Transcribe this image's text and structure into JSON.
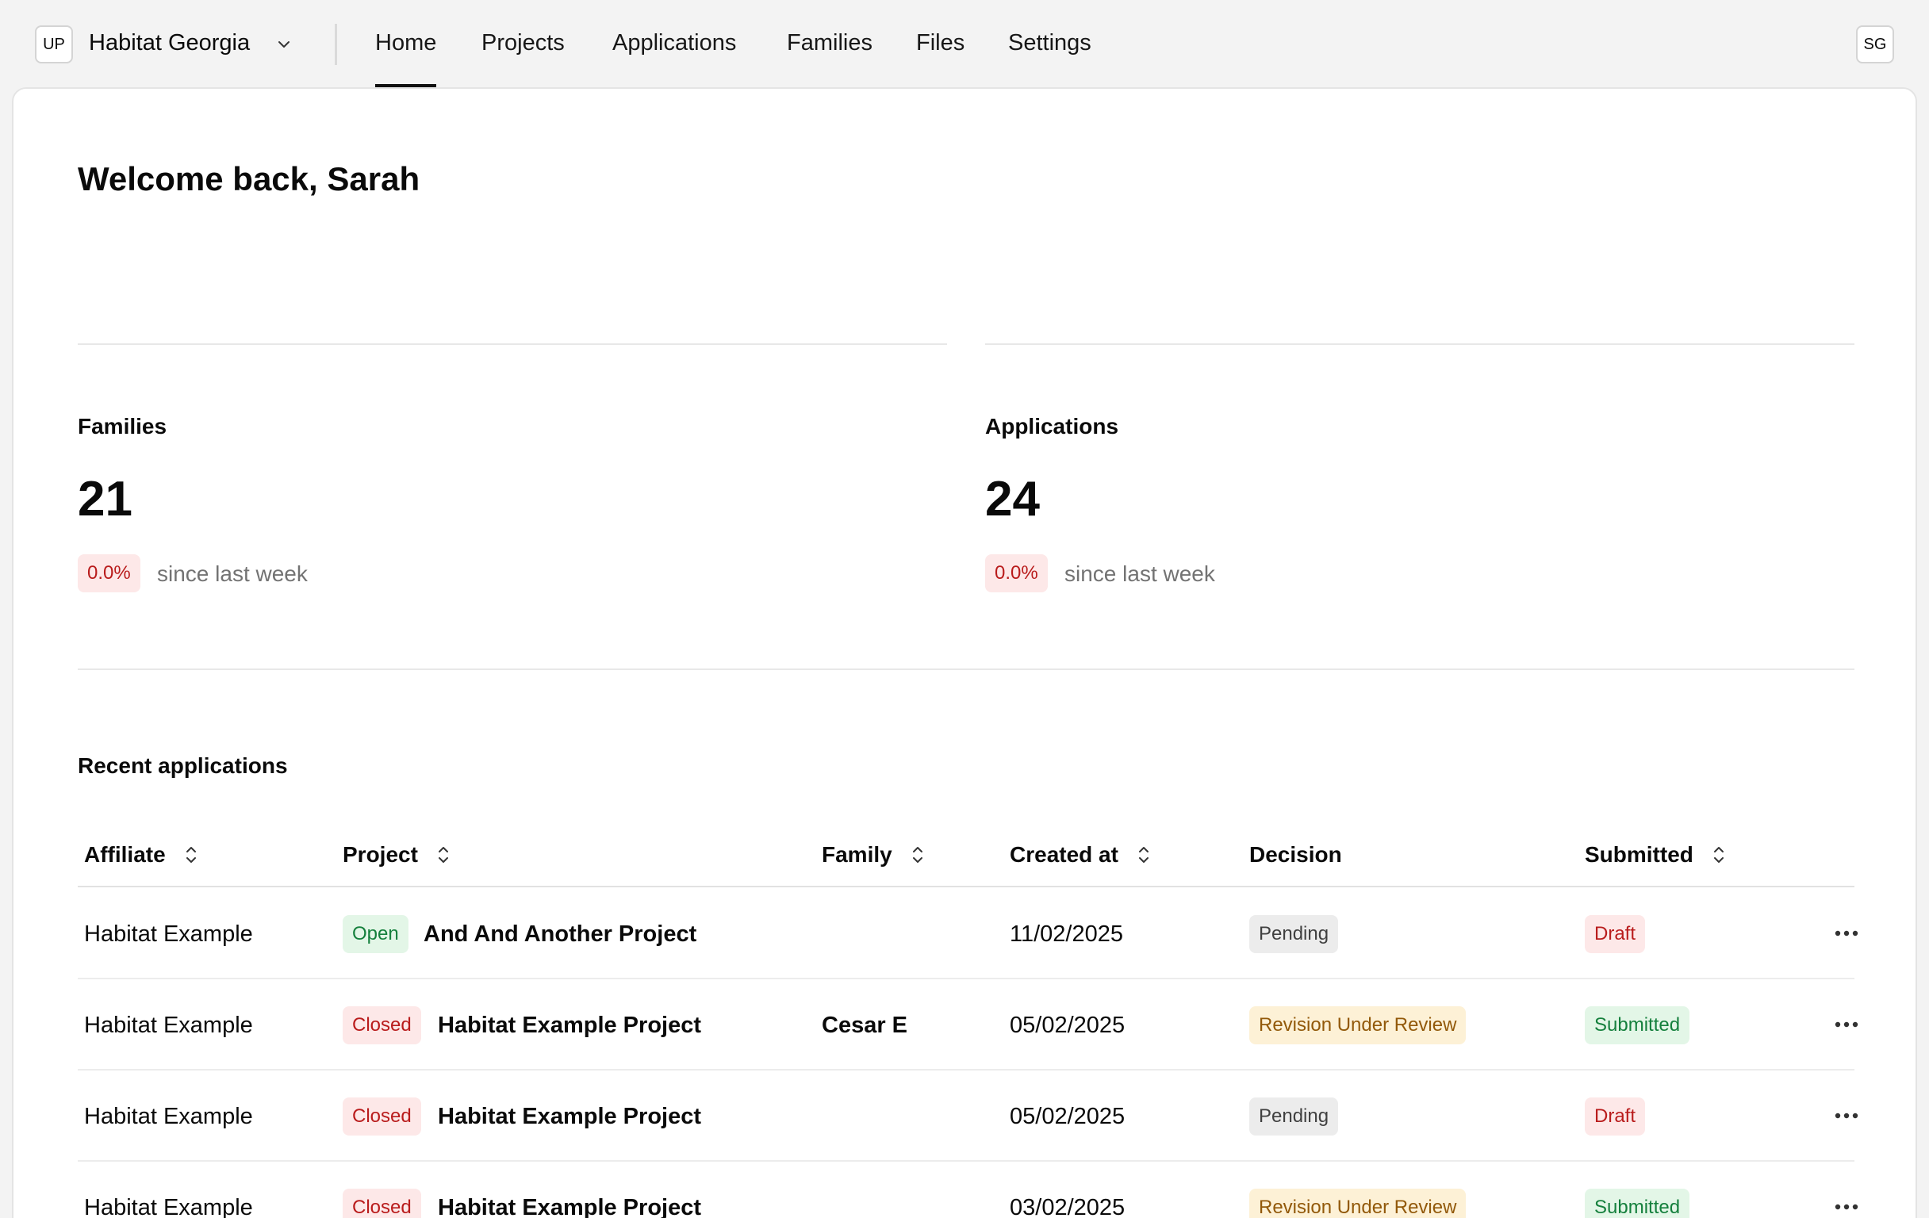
{
  "header": {
    "org_initials": "UP",
    "org_name": "Habitat Georgia",
    "user_initials": "SG",
    "nav": [
      {
        "label": "Home",
        "active": true
      },
      {
        "label": "Projects"
      },
      {
        "label": "Applications"
      },
      {
        "label": "Families"
      },
      {
        "label": "Files"
      },
      {
        "label": "Settings"
      }
    ]
  },
  "main": {
    "welcome": "Welcome back, Sarah",
    "stats": [
      {
        "label": "Families",
        "value": "21",
        "change": "0.0%",
        "caption": "since last week"
      },
      {
        "label": "Applications",
        "value": "24",
        "change": "0.0%",
        "caption": "since last week"
      }
    ],
    "recent_title": "Recent applications",
    "table": {
      "columns": [
        "Affiliate",
        "Project",
        "Family",
        "Created at",
        "Decision",
        "Submitted"
      ],
      "rows": [
        {
          "affiliate": "Habitat Example",
          "status": "Open",
          "project": "And And Another Project",
          "family": "",
          "created": "11/02/2025",
          "decision": "Pending",
          "submitted": "Draft"
        },
        {
          "affiliate": "Habitat Example",
          "status": "Closed",
          "project": "Habitat Example Project",
          "family": "Cesar E",
          "created": "05/02/2025",
          "decision": "Revision Under Review",
          "submitted": "Submitted"
        },
        {
          "affiliate": "Habitat Example",
          "status": "Closed",
          "project": "Habitat Example Project",
          "family": "",
          "created": "05/02/2025",
          "decision": "Pending",
          "submitted": "Draft"
        },
        {
          "affiliate": "Habitat Example",
          "status": "Closed",
          "project": "Habitat Example Project",
          "family": "",
          "created": "03/02/2025",
          "decision": "Revision Under Review",
          "submitted": "Submitted"
        }
      ]
    }
  },
  "colors": {
    "open_bg": "#e3f6e7",
    "open_fg": "#15803d",
    "closed_bg": "#fde8e8",
    "closed_fg": "#b91c1c",
    "pending_bg": "#ececec",
    "pending_fg": "#404040",
    "review_bg": "#fdf1d6",
    "review_fg": "#92590a",
    "submitted_bg": "#e3f6e7",
    "submitted_fg": "#15803d",
    "draft_bg": "#fde8e8",
    "draft_fg": "#b91c1c"
  }
}
